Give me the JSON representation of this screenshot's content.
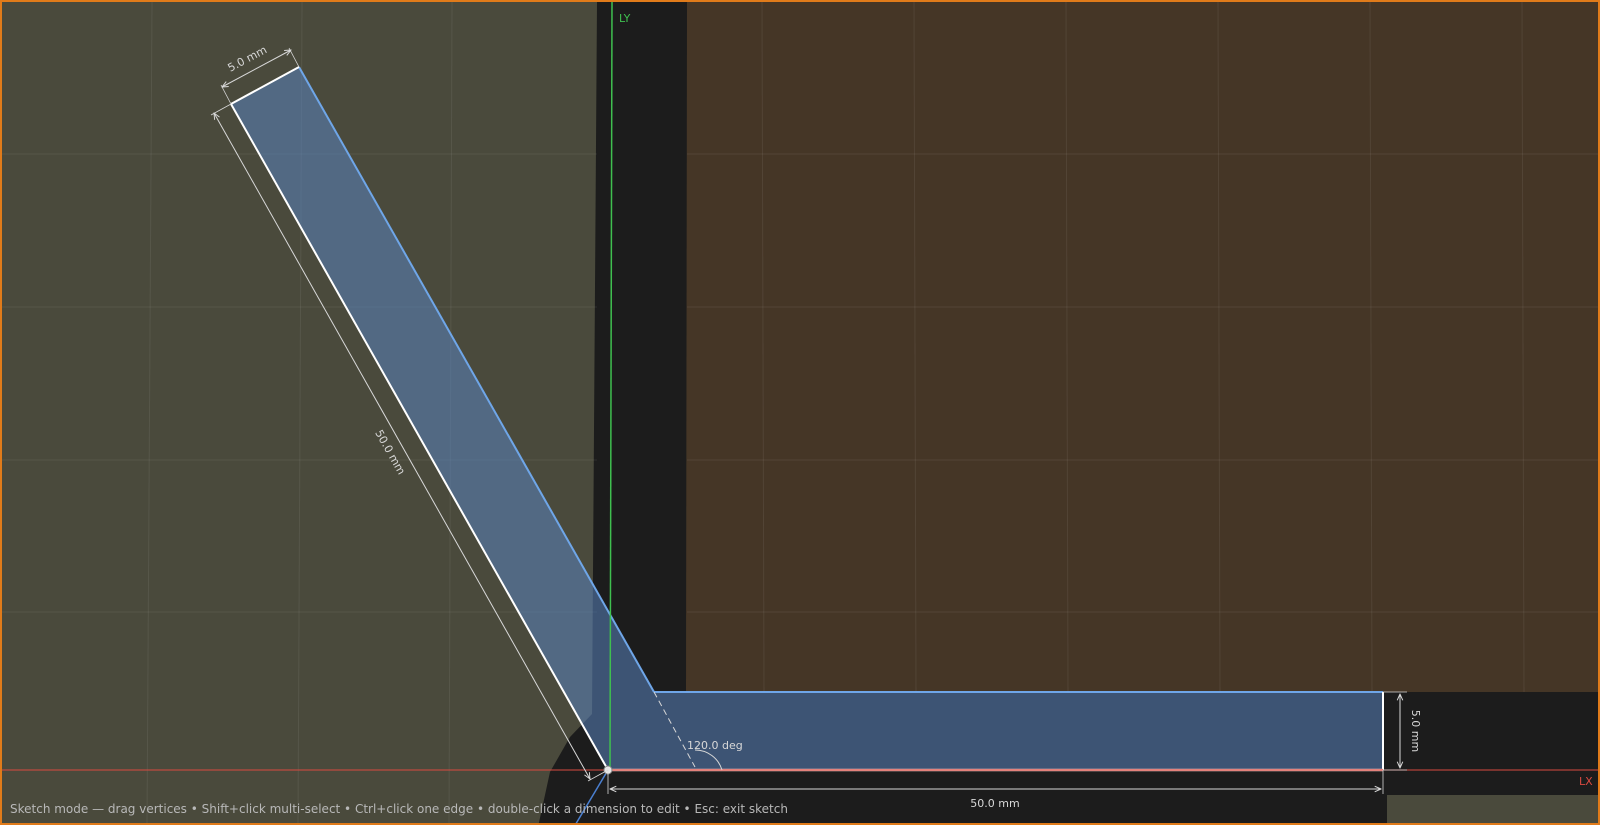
{
  "viewport": {
    "border_color": "#e07b1a"
  },
  "axes": {
    "y_label": "LY",
    "x_label": "LX",
    "y_color": "#3fbf4f",
    "x_color": "#d94a40"
  },
  "dimensions": {
    "arm_width": "5.0 mm",
    "arm_length": "50.0 mm",
    "angle": "120.0 deg",
    "base_length": "50.0 mm",
    "base_height": "5.0 mm"
  },
  "colors": {
    "sketch_fill": "#4a6f9e",
    "sketch_edge": "#6fa6e8",
    "selected_edge": "#ffffff",
    "ground_olive": "#4a4a3c",
    "ground_brown": "#453626"
  },
  "status_bar": {
    "text": "Sketch mode — drag vertices • Shift+click multi-select • Ctrl+click one edge • double-click a dimension to edit • Esc: exit sketch"
  }
}
